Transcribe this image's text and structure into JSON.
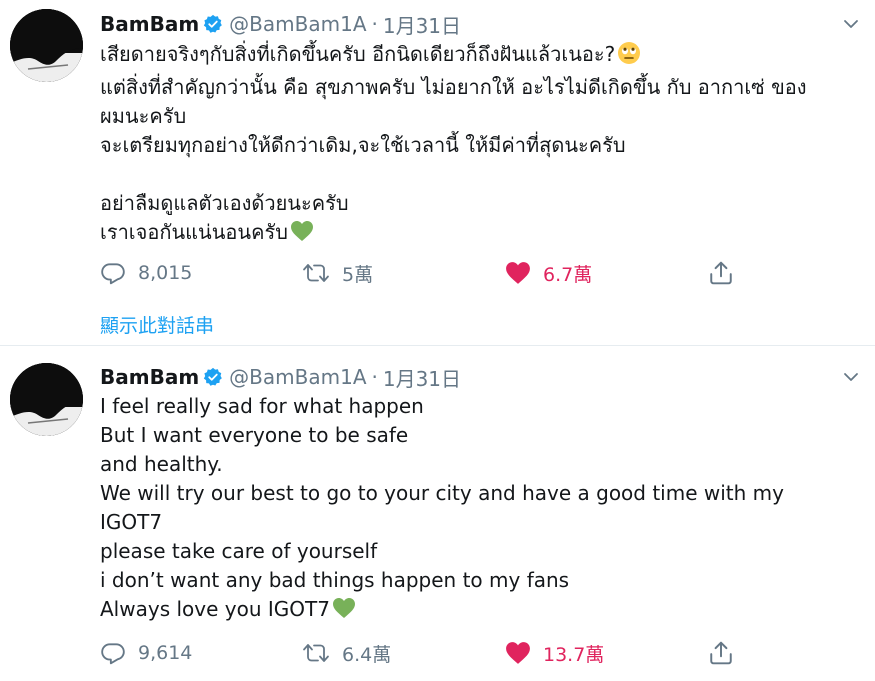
{
  "colors": {
    "link": "#1da1f2",
    "secondary_text": "#657786",
    "like_active": "#e0245e",
    "verified": "#1da1f2",
    "emoji_heart": "#78b159"
  },
  "tweets": [
    {
      "name": "BamBam",
      "handle": "@BamBam1A",
      "separator": "·",
      "date": "1月31日",
      "lines": [
        "เสียดายจริงๆกับสิ่งที่เกิดขึ้นครับ อีกนิดเดียวก็ถึงฝันแล้วเนอะ?",
        "แต่สิ่งที่สำคัญกว่านั้น คือ สุขภาพครับ ไม่อยากให้ อะไรไม่ดีเกิดขึ้น กับ อากาเซ่ ของ",
        "ผมนะครับ",
        "จะเตรียมทุกอย่างให้ดีกว่าเดิม,จะใช้เวลานี้ ให้มีค่าที่สุดนะครับ",
        "",
        "อย่าลืมดูแลตัวเองด้วยนะครับ",
        "เราเจอกันแน่นอนครับ"
      ],
      "emoji": [
        "face-with-rolling-eyes",
        "green-heart"
      ],
      "replies": "8,015",
      "retweets": "5萬",
      "likes": "6.7萬",
      "show_thread": "顯示此對話串"
    },
    {
      "name": "BamBam",
      "handle": "@BamBam1A",
      "separator": "·",
      "date": "1月31日",
      "lines": [
        "I feel really sad for what happen",
        "But I want everyone to be safe",
        "and healthy.",
        "We will try our best to go to your city and have a good time with my",
        "IGOT7",
        "please take care of yourself",
        "i don’t want any bad things happen to my fans",
        "Always love you IGOT7"
      ],
      "emoji": [
        "green-heart"
      ],
      "replies": "9,614",
      "retweets": "6.4萬",
      "likes": "13.7萬"
    }
  ]
}
